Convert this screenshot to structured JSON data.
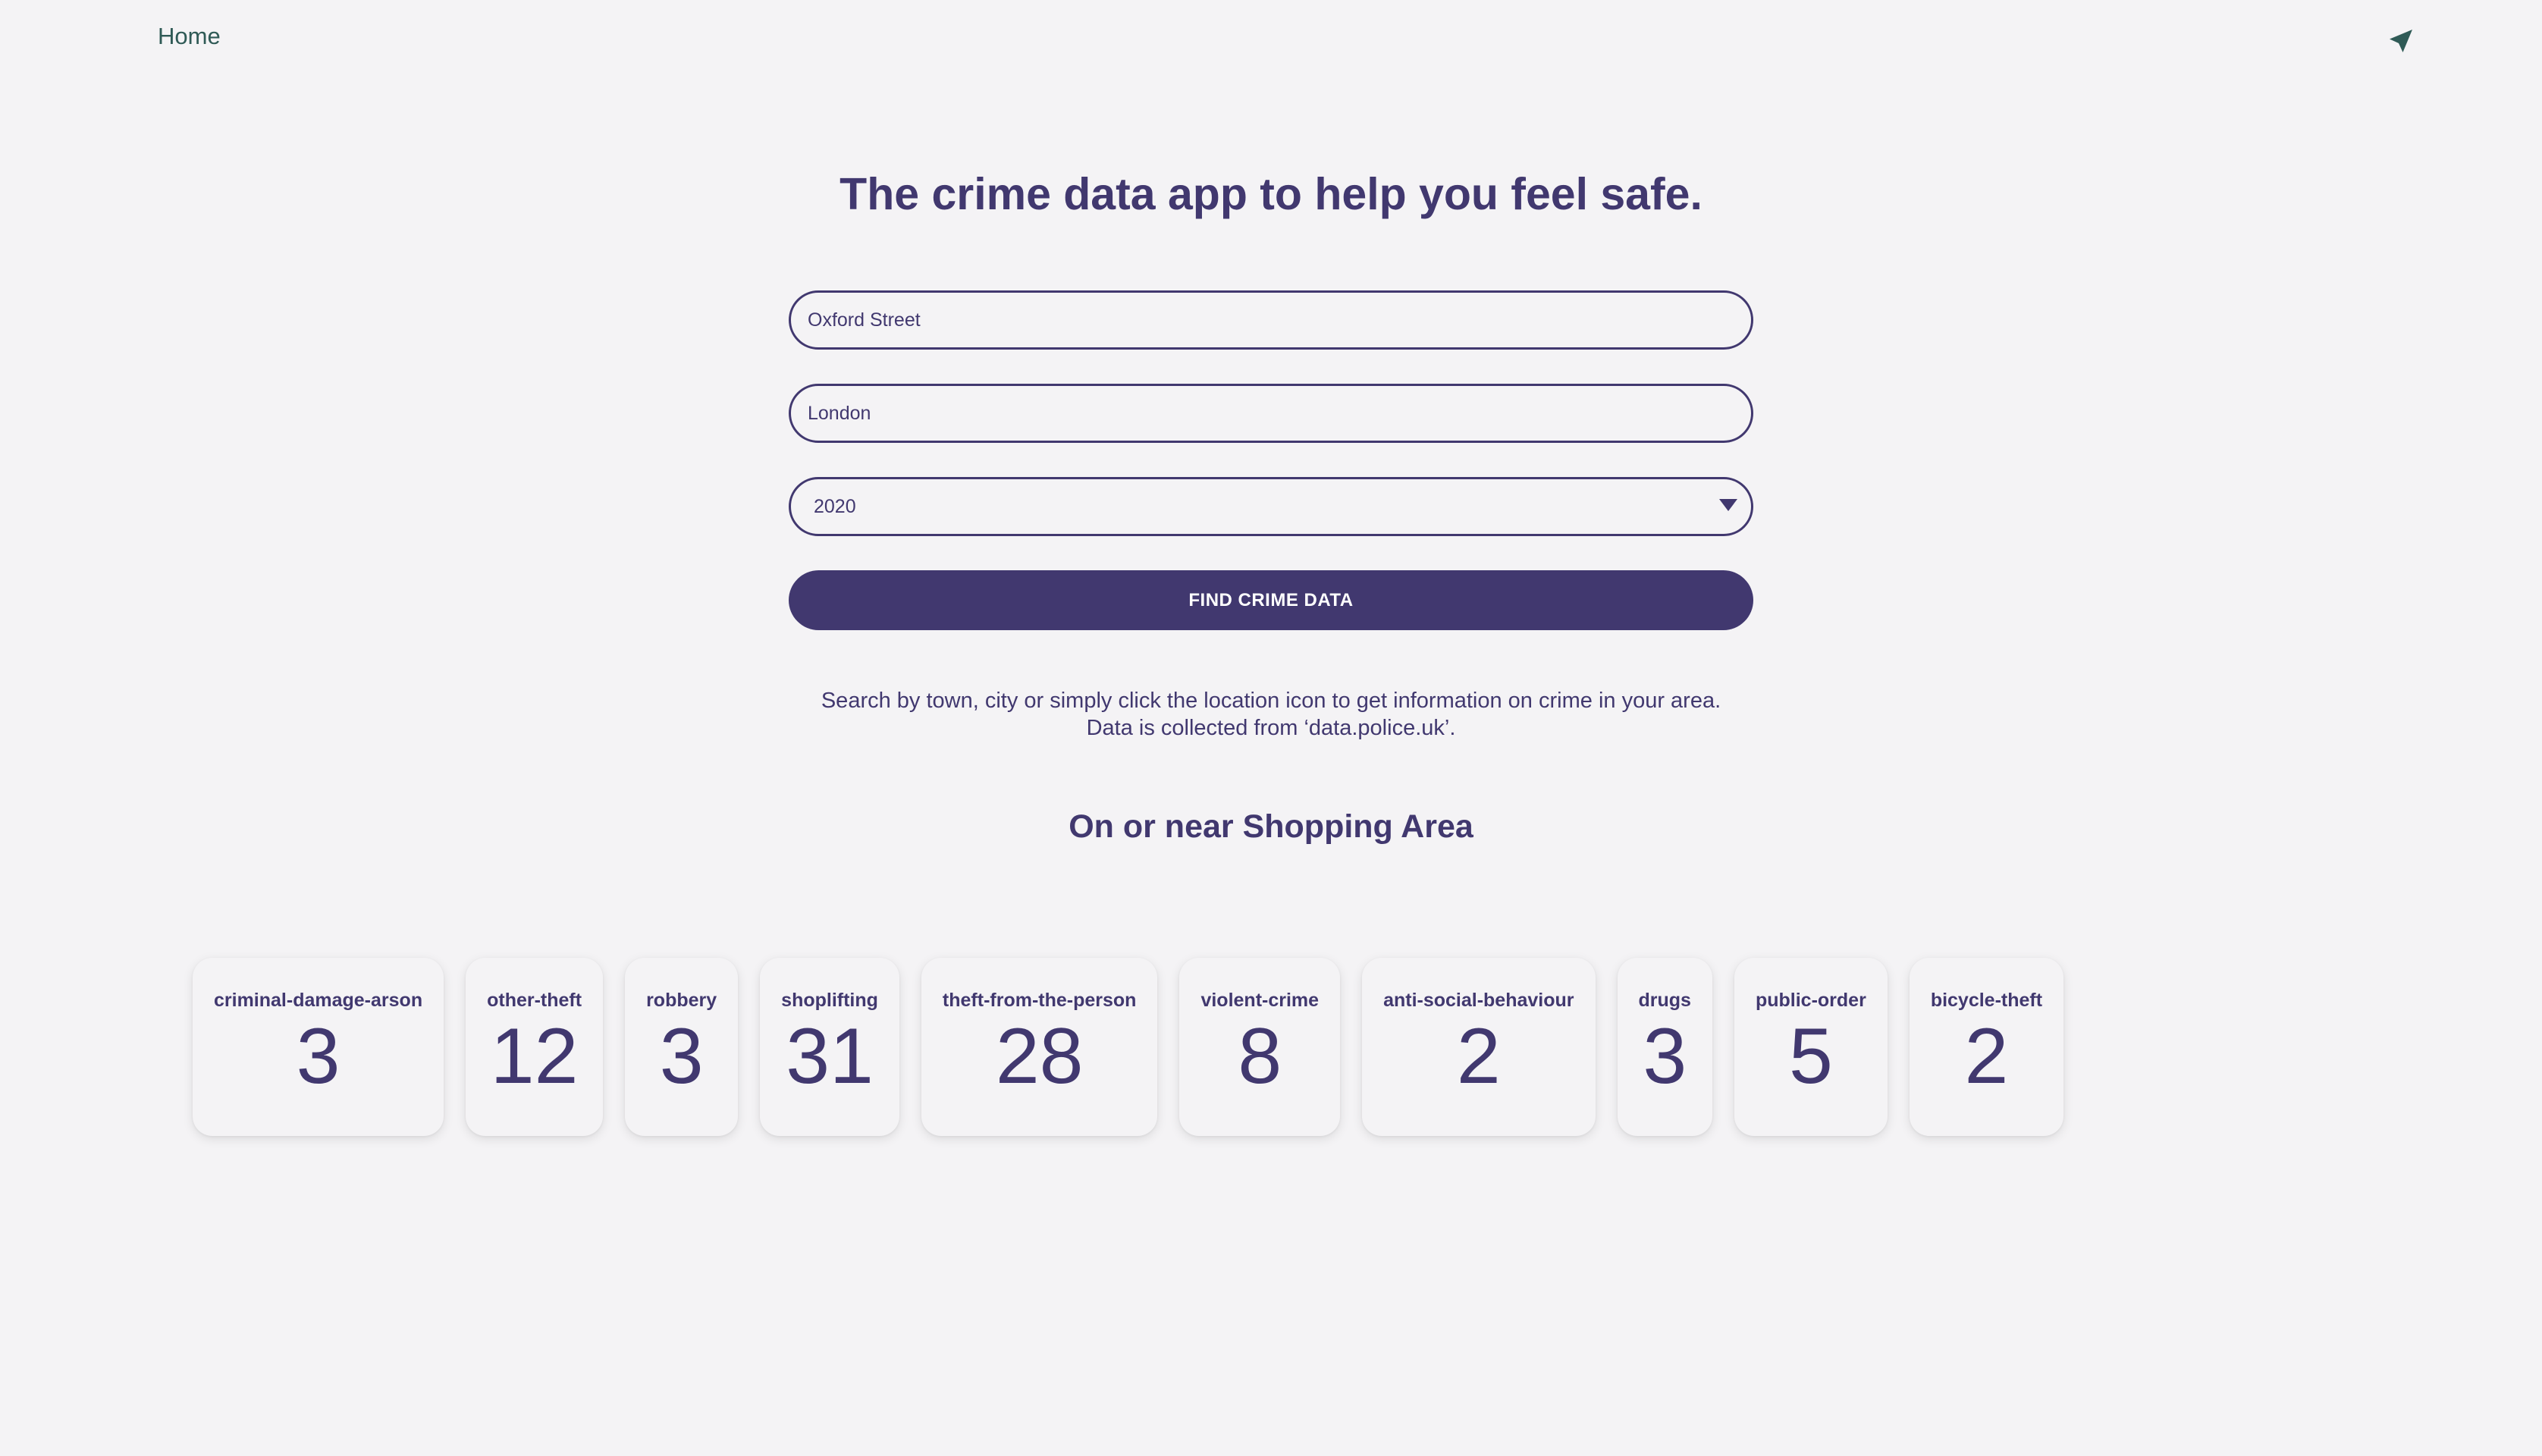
{
  "nav": {
    "home_label": "Home",
    "location_icon": "location-arrow-icon"
  },
  "hero": {
    "title": "The crime data app to help you feel safe."
  },
  "form": {
    "street_value": "Oxford Street",
    "city_value": "London",
    "year_value": "2020",
    "submit_label": "FIND CRIME DATA"
  },
  "info": {
    "line1": "Search by town, city or simply click the location icon to get information on crime in your area.",
    "line2": "Data is collected from ‘data.police.uk’."
  },
  "results": {
    "title": "On or near Shopping Area",
    "cards": [
      {
        "label": "criminal-damage-arson",
        "value": "3"
      },
      {
        "label": "other-theft",
        "value": "12"
      },
      {
        "label": "robbery",
        "value": "3"
      },
      {
        "label": "shoplifting",
        "value": "31"
      },
      {
        "label": "theft-from-the-person",
        "value": "28"
      },
      {
        "label": "violent-crime",
        "value": "8"
      },
      {
        "label": "anti-social-behaviour",
        "value": "2"
      },
      {
        "label": "drugs",
        "value": "3"
      },
      {
        "label": "public-order",
        "value": "5"
      },
      {
        "label": "bicycle-theft",
        "value": "2"
      }
    ]
  },
  "colors": {
    "background": "#f4f3f5",
    "primary": "#41386f",
    "nav_accent": "#2f5a56"
  }
}
